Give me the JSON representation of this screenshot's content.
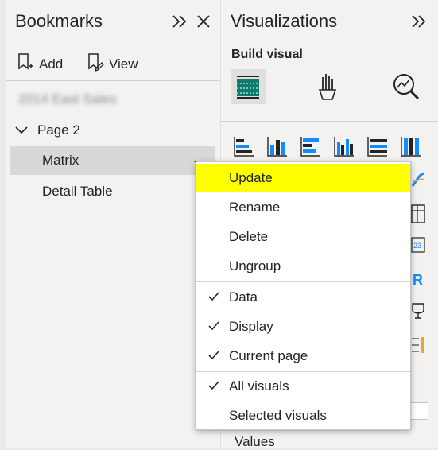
{
  "bookmarks": {
    "title": "Bookmarks",
    "add_label": "Add",
    "view_label": "View",
    "items": [
      {
        "label": "2014 East Sales",
        "blurred": true
      },
      {
        "label": "Page 2"
      },
      {
        "label": "Matrix",
        "selected": true
      },
      {
        "label": "Detail Table"
      }
    ],
    "more_options": "..."
  },
  "visualizations": {
    "title": "Visualizations",
    "build_visual_label": "Build visual",
    "values_label": "Values",
    "tool_icons": [
      "build-visual-icon",
      "format-visual-icon",
      "analytics-icon"
    ]
  },
  "context_menu": {
    "items": [
      {
        "label": "Update",
        "highlighted": true
      },
      {
        "label": "Rename"
      },
      {
        "label": "Delete"
      },
      {
        "label": "Ungroup"
      },
      {
        "label": "Data",
        "checked": true
      },
      {
        "label": "Display",
        "checked": true
      },
      {
        "label": "Current page",
        "checked": true
      },
      {
        "label": "All visuals",
        "checked": true
      },
      {
        "label": "Selected visuals"
      }
    ]
  },
  "colors": {
    "accent_teal": "#0f7b6c",
    "accent_blue": "#118dff",
    "highlight": "#ffff00",
    "selection": "#d8d8d8"
  }
}
